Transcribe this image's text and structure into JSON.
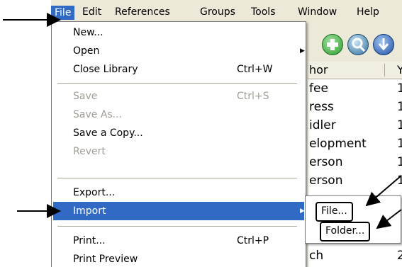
{
  "menubar": {
    "items": [
      "File",
      "Edit",
      "References",
      "Groups",
      "Tools",
      "Window",
      "Help"
    ]
  },
  "file_menu": {
    "items": [
      {
        "label": "New...",
        "shortcut": "",
        "disabled": false,
        "submenu": false
      },
      {
        "label": "Open",
        "shortcut": "",
        "disabled": false,
        "submenu": true
      },
      {
        "label": "Close Library",
        "shortcut": "Ctrl+W",
        "disabled": false,
        "submenu": false
      },
      {
        "label": "Save",
        "shortcut": "Ctrl+S",
        "disabled": true,
        "submenu": false
      },
      {
        "label": "Save As...",
        "shortcut": "",
        "disabled": true,
        "submenu": false
      },
      {
        "label": "Save a Copy...",
        "shortcut": "",
        "disabled": false,
        "submenu": false
      },
      {
        "label": "Revert",
        "shortcut": "",
        "disabled": true,
        "submenu": false
      },
      {
        "label": "Export...",
        "shortcut": "",
        "disabled": false,
        "submenu": false
      },
      {
        "label": "Import",
        "shortcut": "",
        "disabled": false,
        "submenu": true,
        "highlighted": true
      },
      {
        "label": "Print...",
        "shortcut": "Ctrl+P",
        "disabled": false,
        "submenu": false
      },
      {
        "label": "Print Preview",
        "shortcut": "",
        "disabled": false,
        "submenu": false
      }
    ]
  },
  "import_submenu": {
    "items": [
      "File...",
      "Folder..."
    ]
  },
  "toolbar": {
    "icons": [
      "add-reference-icon",
      "find-icon",
      "download-icon"
    ]
  },
  "reference_list": {
    "header_author": "hor",
    "header_year": "Y",
    "rows": [
      {
        "author": "fee",
        "year": "1"
      },
      {
        "author": "ress",
        "year": "1"
      },
      {
        "author": "idler",
        "year": "1"
      },
      {
        "author": "elopment",
        "year": "1"
      },
      {
        "author": "erson",
        "year": "1"
      },
      {
        "author": "erson",
        "year": "1"
      },
      {
        "author": "ch",
        "year": "2"
      }
    ]
  },
  "colors": {
    "highlight": "#316ac5",
    "menu_bg": "#ffffff",
    "chrome": "#ece9d8",
    "disabled_text": "#a19d94"
  }
}
